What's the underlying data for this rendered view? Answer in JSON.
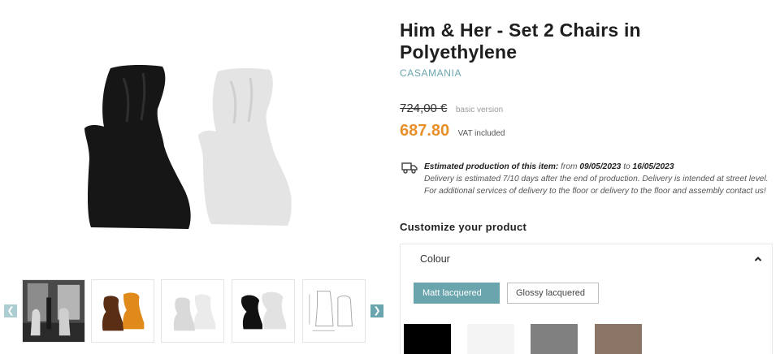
{
  "product": {
    "title": "Him & Her - Set 2 Chairs in Polyethylene",
    "brand": "CASAMANIA"
  },
  "pricing": {
    "old_price": "724,00 €",
    "old_price_note": "basic version",
    "price": "687.80",
    "vat_note": "VAT included"
  },
  "delivery": {
    "label": "Estimated production of this item:",
    "from_word": "from",
    "from_date": "09/05/2023",
    "to_word": "to",
    "to_date": "16/05/2023",
    "details": "Delivery is estimated 7/10 days after the end of production. Delivery is intended at street level. For additional services of delivery to the floor or delivery to the floor and assembly contact us!",
    "icon": "truck-icon"
  },
  "customize": {
    "heading": "Customize your product",
    "colour_label": "Colour",
    "finish_options": [
      "Matt lacquered",
      "Glossy lacquered"
    ],
    "selected_finish": "Matt lacquered",
    "swatch_colors": [
      "#000000",
      "#f4f4f4",
      "#808080",
      "#8a7566"
    ]
  },
  "gallery": {
    "thumbnail_count": 5,
    "prev_icon": "chevron-left-icon",
    "next_icon": "chevron-right-icon"
  },
  "colors": {
    "accent": "#6aa5ad",
    "price": "#e8902b"
  }
}
